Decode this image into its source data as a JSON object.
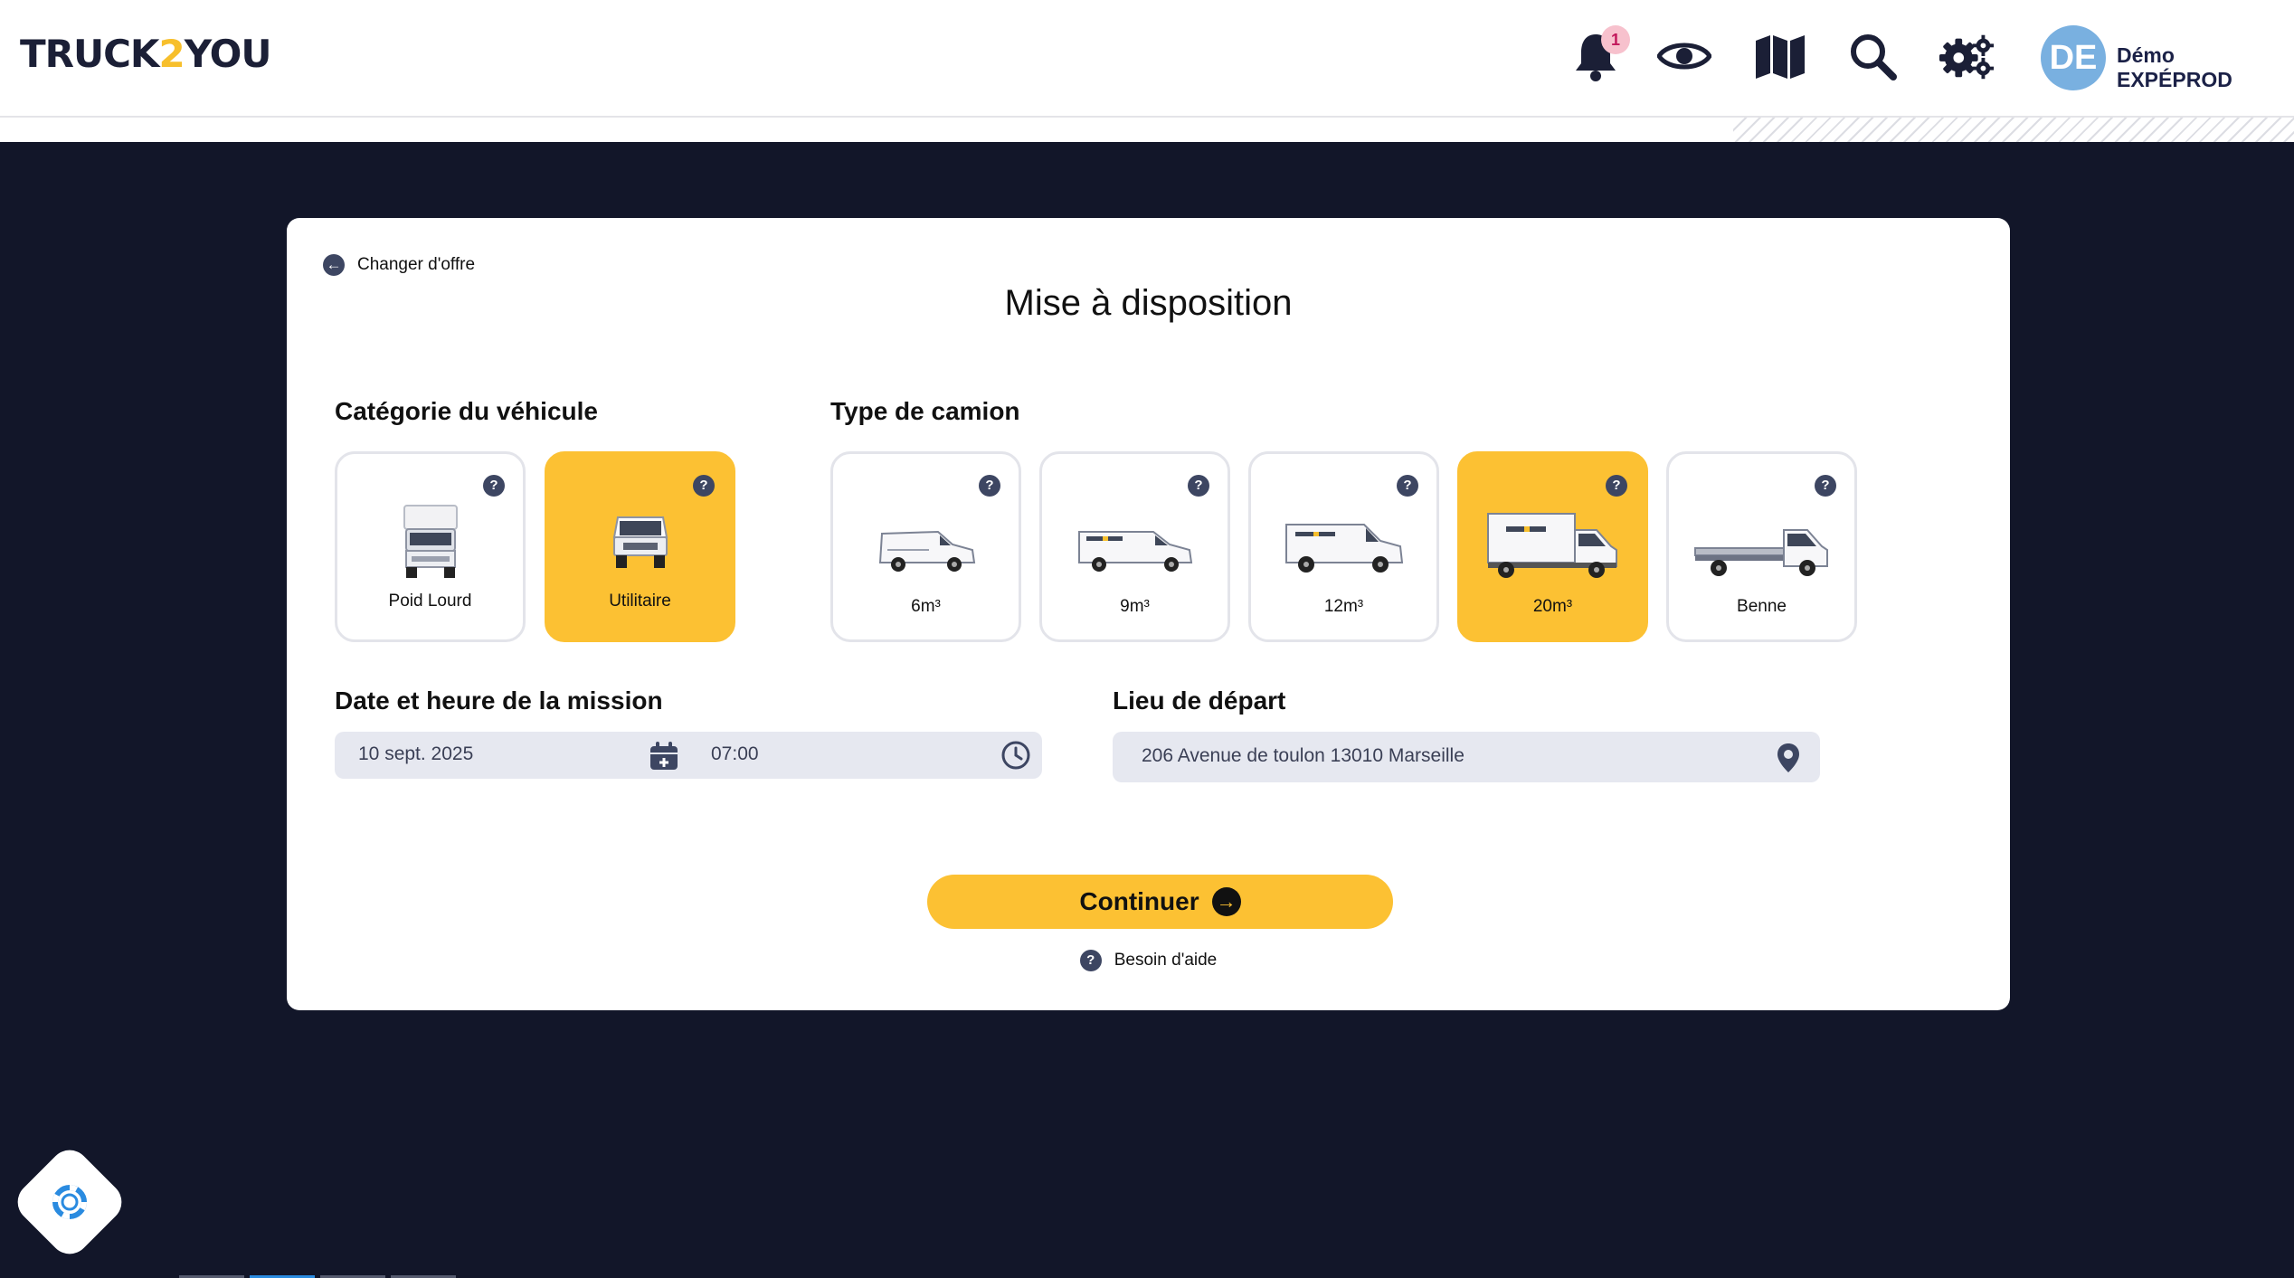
{
  "app": {
    "logo_part1": "TRUCK",
    "logo_part2": "2",
    "logo_part3": "YOU"
  },
  "header": {
    "notification_count": "1",
    "icons": [
      "bell-icon",
      "eye-icon",
      "map-icon",
      "search-icon",
      "settings-icon"
    ],
    "user_initials": "DE",
    "user_name": "Démo EXPÉPROD"
  },
  "card": {
    "back_label": "Changer d'offre",
    "title": "Mise à disposition",
    "vehicle_category": {
      "title": "Catégorie du véhicule",
      "options": [
        {
          "label": "Poid Lourd",
          "selected": false
        },
        {
          "label": "Utilitaire",
          "selected": true
        }
      ]
    },
    "truck_type": {
      "title": "Type de camion",
      "options": [
        {
          "label": "6m³",
          "selected": false
        },
        {
          "label": "9m³",
          "selected": false
        },
        {
          "label": "12m³",
          "selected": false
        },
        {
          "label": "20m³",
          "selected": true
        },
        {
          "label": "Benne",
          "selected": false
        }
      ]
    },
    "mission": {
      "title": "Date et heure de la mission",
      "date": "10 sept. 2025",
      "time": "07:00"
    },
    "departure": {
      "title": "Lieu de départ",
      "address": "206 Avenue de toulon 13010 Marseille"
    },
    "continue_label": "Continuer",
    "help_label": "Besoin d'aide",
    "question_mark": "?"
  },
  "colors": {
    "accent": "#fcc133",
    "background": "#121629",
    "icon": "#1b1f36"
  }
}
